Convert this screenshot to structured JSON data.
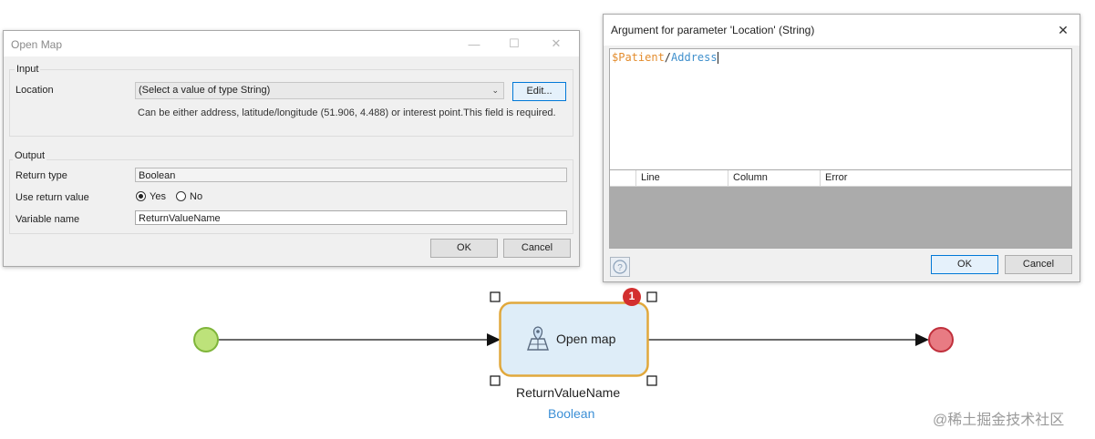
{
  "open_map_dialog": {
    "title": "Open Map",
    "input_group": "Input",
    "location_label": "Location",
    "location_value": "(Select a value of type String)",
    "edit_button": "Edit...",
    "hint": "Can be either address, latitude/longitude (51.906, 4.488) or interest point.This field is required.",
    "output_group": "Output",
    "return_type_label": "Return type",
    "return_type_value": "Boolean",
    "use_return_label": "Use return value",
    "yes": "Yes",
    "no": "No",
    "variable_name_label": "Variable name",
    "variable_name_value": "ReturnValueName",
    "ok": "OK",
    "cancel": "Cancel"
  },
  "argument_dialog": {
    "title": "Argument for parameter 'Location' (String)",
    "expr_var": "$Patient",
    "expr_sep": "/",
    "expr_attr": "Address",
    "columns": [
      "Line",
      "Column",
      "Error"
    ],
    "ok": "OK",
    "cancel": "Cancel"
  },
  "flow": {
    "activity_label": "Open map",
    "badge_count": "1",
    "variable_name": "ReturnValueName",
    "variable_type": "Boolean"
  },
  "watermark": "@稀土掘金技术社区",
  "colors": {
    "start": "#bde27a",
    "end": "#e87b83",
    "activity_fill": "#deedf8",
    "activity_border": "#e1a83c",
    "badge": "#d32f2f",
    "type_text": "#3b8fd6",
    "expr_var": "#e38c2d",
    "expr_attr": "#3f8fcc"
  }
}
